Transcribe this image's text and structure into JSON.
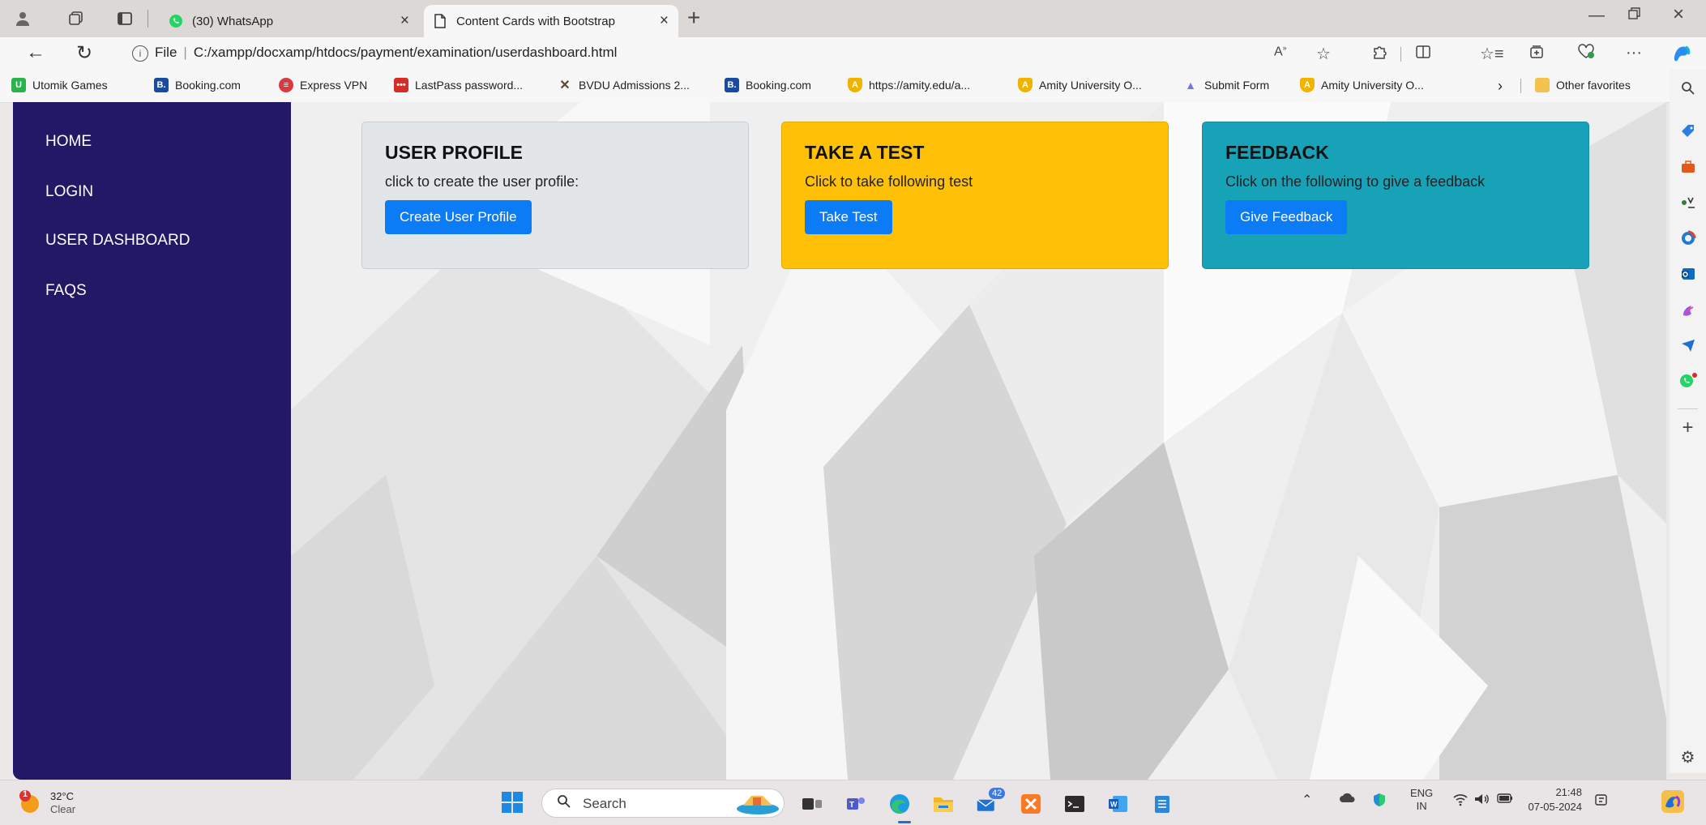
{
  "browser": {
    "tabs": [
      {
        "label": "(30) WhatsApp",
        "active": false,
        "icon": "whatsapp-icon"
      },
      {
        "label": "Content Cards with Bootstrap",
        "active": true,
        "icon": "page-icon"
      }
    ],
    "address": {
      "scheme": "File",
      "path": "C:/xampp/docxamp/htdocs/payment/examination/userdashboard.html"
    },
    "favorites": [
      {
        "label": "Utomik Games",
        "icon": "utomik-icon",
        "color": "#2bb34b"
      },
      {
        "label": "Booking.com",
        "icon": "booking-icon",
        "color": "#1a4c9c"
      },
      {
        "label": "Express VPN",
        "icon": "expressvpn-icon",
        "color": "#da3940"
      },
      {
        "label": "LastPass password...",
        "icon": "lastpass-icon",
        "color": "#d32d27"
      },
      {
        "label": "BVDU Admissions 2...",
        "icon": "bvdu-icon",
        "color": "#5b4a2e"
      },
      {
        "label": "Booking.com",
        "icon": "booking-icon",
        "color": "#1a4c9c"
      },
      {
        "label": "https://amity.edu/a...",
        "icon": "amity-icon",
        "color": "#f0b400"
      },
      {
        "label": "Amity University O...",
        "icon": "amity-icon",
        "color": "#f0b400"
      },
      {
        "label": "Submit Form",
        "icon": "form-icon",
        "color": "#6b7be8"
      },
      {
        "label": "Amity University O...",
        "icon": "amity-icon",
        "color": "#f0b400"
      }
    ],
    "other_favorites": "Other favorites"
  },
  "sidebar": {
    "items": [
      {
        "label": "HOME"
      },
      {
        "label": "LOGIN"
      },
      {
        "label": "USER DASHBOARD"
      },
      {
        "label": "FAQS"
      }
    ]
  },
  "cards": [
    {
      "title": "USER PROFILE",
      "text": "click to create the user profile:",
      "button": "Create User Profile",
      "color": "#e3e6e9"
    },
    {
      "title": "TAKE A TEST",
      "text": "Click to take following test",
      "button": "Take Test",
      "color": "#ffc108"
    },
    {
      "title": "FEEDBACK",
      "text": "Click on the following to give a feedback",
      "button": "Give Feedback",
      "color": "#18a2b8"
    }
  ],
  "taskbar": {
    "weather": {
      "temp": "32°C",
      "desc": "Clear",
      "badge": "1"
    },
    "search_label": "Search",
    "mail_badge": "42",
    "lang_top": "ENG",
    "lang_bottom": "IN",
    "time": "21:48",
    "date": "07-05-2024"
  }
}
